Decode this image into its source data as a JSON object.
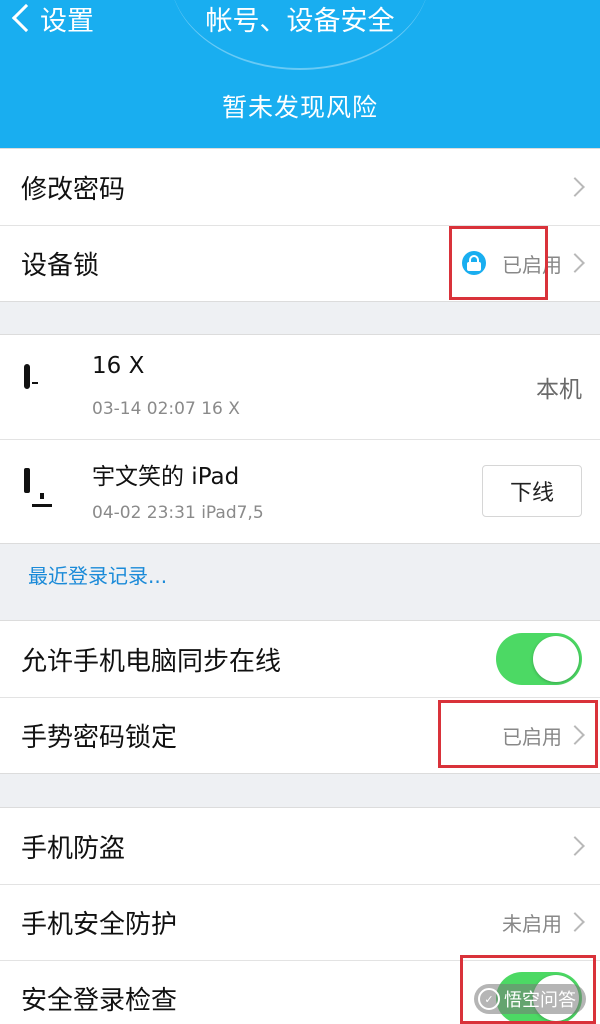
{
  "header": {
    "back_label": "设置",
    "title": "帐号、设备安全",
    "risk_text": "暂未发现风险",
    "color": "#19aef0"
  },
  "section1": {
    "change_password": "修改密码",
    "device_lock": {
      "label": "设备锁",
      "status": "已启用",
      "icon": "lock-icon"
    }
  },
  "devices": [
    {
      "icon": "phone-icon",
      "name": "16 X",
      "time": "03-14 02:07 16 X",
      "right": "本机"
    },
    {
      "icon": "monitor-icon",
      "name": "宇文笑的 iPad",
      "time": "04-02 23:31 iPad7,5",
      "button": "下线"
    }
  ],
  "recent_login_link": "最近登录记录...",
  "section3": {
    "sync_online": {
      "label": "允许手机电脑同步在线",
      "enabled": true
    },
    "gesture_lock": {
      "label": "手势密码锁定",
      "status": "已启用"
    }
  },
  "section4": {
    "anti_theft": {
      "label": "手机防盗"
    },
    "security_protection": {
      "label": "手机安全防护",
      "status": "未启用"
    },
    "safe_login_check": {
      "label": "安全登录检查",
      "enabled": true
    }
  },
  "watermark": {
    "text": "悟空问答"
  },
  "colors": {
    "toggle_on": "#4cd964",
    "highlight_box": "#d9323a",
    "link": "#1a8ad8"
  }
}
